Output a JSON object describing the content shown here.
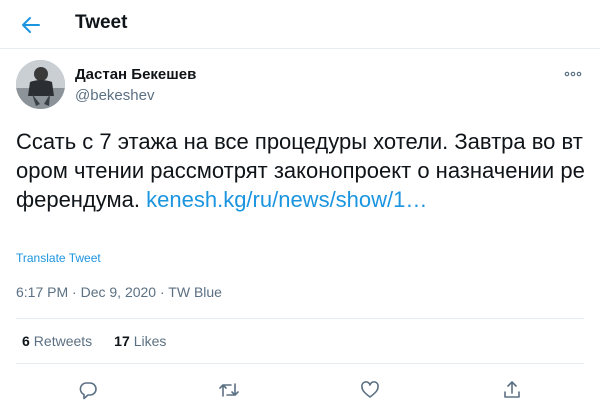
{
  "header": {
    "title": "Tweet",
    "back_icon": "arrow-left-icon"
  },
  "author": {
    "name": "Дастан Бекешев",
    "handle": "@bekeshev"
  },
  "tweet": {
    "text": "Ссать с 7 этажа на все процедуры хотели. Завтра во втором чтении рассмотрят законопроект о назначении референдума. ",
    "link_text": "kenesh.kg/ru/news/show/1…",
    "translate_label": "Translate Tweet",
    "time": "6:17 PM",
    "date": "Dec 9, 2020",
    "source": "TW Blue",
    "separator": " · "
  },
  "stats": {
    "retweets_count": "6",
    "retweets_label": "Retweets",
    "likes_count": "17",
    "likes_label": "Likes"
  },
  "actions": [
    "reply-icon",
    "retweet-icon",
    "like-icon",
    "share-icon"
  ],
  "colors": {
    "accent": "#1b95e0",
    "text": "#0f1419",
    "secondary": "#5b7083",
    "border": "#e6ecf0"
  }
}
